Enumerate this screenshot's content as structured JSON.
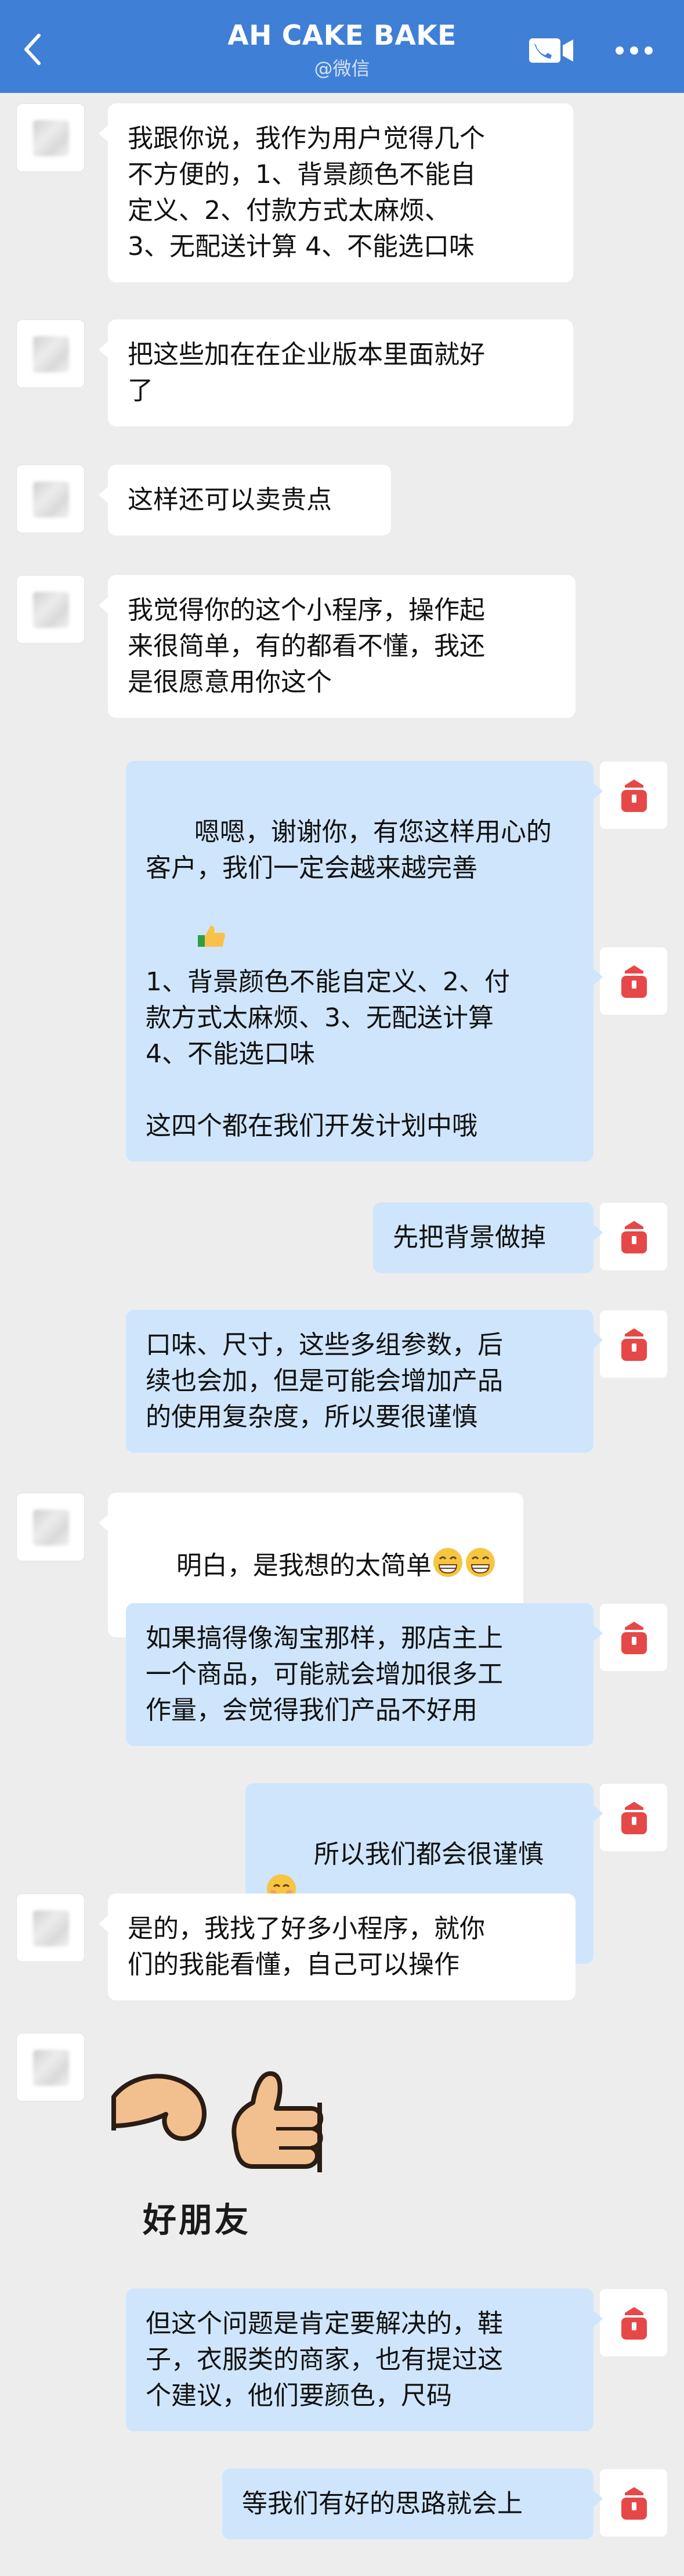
{
  "header": {
    "title": "AH CAKE BAKE",
    "subtitle": "@微信",
    "back_icon": "chevron-left-icon",
    "call_icon": "phone-video-icon",
    "more_icon": "more-dots-icon",
    "bar_color": "#3f7fd6"
  },
  "colors": {
    "background": "#ededed",
    "their_bubble": "#ffffff",
    "my_bubble": "#cfe5fb",
    "my_avatar_icon": "#e64848"
  },
  "messages": [
    {
      "sender": "them",
      "text": "我跟你说，我作为用户觉得几个\n不方便的，1、背景颜色不能自\n定义、2、付款方式太麻烦、\n3、无配送计算 4、不能选口味"
    },
    {
      "sender": "them",
      "text": "把这些加在在企业版本里面就好\n了"
    },
    {
      "sender": "them",
      "text": "这样还可以卖贵点"
    },
    {
      "sender": "them",
      "text": "我觉得你的这个小程序，操作起\n来很简单，有的都看不懂，我还\n是很愿意用你这个"
    },
    {
      "sender": "me",
      "text": "嗯嗯，谢谢你，有您这样用心的\n客户，我们一定会越来越完善",
      "emoji": "thumbs-up-emoji"
    },
    {
      "sender": "me",
      "text": "1、背景颜色不能自定义、2、付\n款方式太麻烦、3、无配送计算\n4、不能选口味\n\n这四个都在我们开发计划中哦"
    },
    {
      "sender": "me",
      "text": "先把背景做掉"
    },
    {
      "sender": "me",
      "text": "口味、尺寸，这些多组参数，后\n续也会加，但是可能会增加产品\n的使用复杂度，所以要很谨慎"
    },
    {
      "sender": "them",
      "text": "明白，是我想的太简单",
      "emoji": "grin-emoji-x2"
    },
    {
      "sender": "me",
      "text": "如果搞得像淘宝那样，那店主上\n一个商品，可能就会增加很多工\n作量，会觉得我们产品不好用"
    },
    {
      "sender": "me",
      "text": "所以我们都会很谨慎",
      "emoji": "smile-emoji"
    },
    {
      "sender": "them",
      "text": "是的，我找了好多小程序，就你\n们的我能看懂，自己可以操作"
    },
    {
      "sender": "them",
      "sticker": "good-friend-sticker",
      "sticker_text": "好朋友"
    },
    {
      "sender": "me",
      "text": "但这个问题是肯定要解决的，鞋\n子，衣服类的商家，也有提过这\n个建议，他们要颜色，尺码"
    },
    {
      "sender": "me",
      "text": "等我们有好的思路就会上"
    }
  ]
}
